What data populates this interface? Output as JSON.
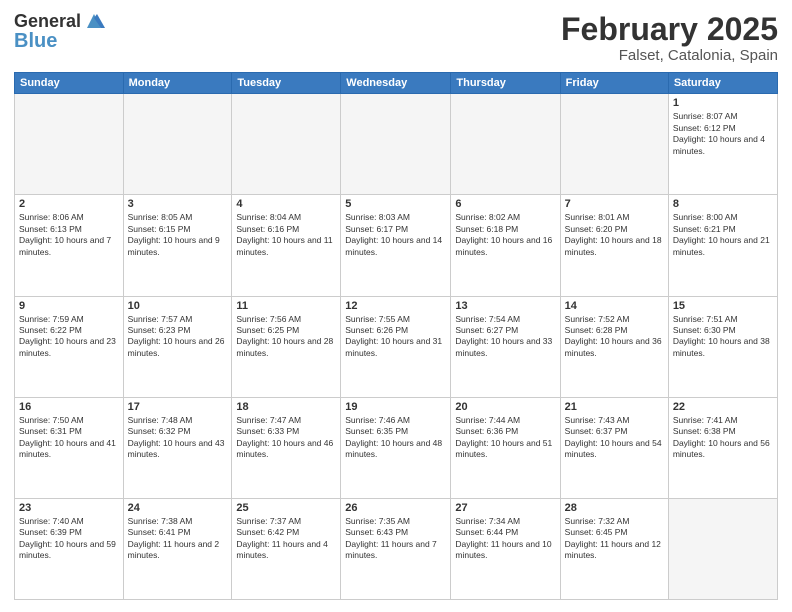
{
  "header": {
    "logo_line1": "General",
    "logo_line2": "Blue",
    "title": "February 2025",
    "subtitle": "Falset, Catalonia, Spain"
  },
  "weekdays": [
    "Sunday",
    "Monday",
    "Tuesday",
    "Wednesday",
    "Thursday",
    "Friday",
    "Saturday"
  ],
  "weeks": [
    [
      {
        "day": "",
        "info": ""
      },
      {
        "day": "",
        "info": ""
      },
      {
        "day": "",
        "info": ""
      },
      {
        "day": "",
        "info": ""
      },
      {
        "day": "",
        "info": ""
      },
      {
        "day": "",
        "info": ""
      },
      {
        "day": "1",
        "info": "Sunrise: 8:07 AM\nSunset: 6:12 PM\nDaylight: 10 hours and 4 minutes."
      }
    ],
    [
      {
        "day": "2",
        "info": "Sunrise: 8:06 AM\nSunset: 6:13 PM\nDaylight: 10 hours and 7 minutes."
      },
      {
        "day": "3",
        "info": "Sunrise: 8:05 AM\nSunset: 6:15 PM\nDaylight: 10 hours and 9 minutes."
      },
      {
        "day": "4",
        "info": "Sunrise: 8:04 AM\nSunset: 6:16 PM\nDaylight: 10 hours and 11 minutes."
      },
      {
        "day": "5",
        "info": "Sunrise: 8:03 AM\nSunset: 6:17 PM\nDaylight: 10 hours and 14 minutes."
      },
      {
        "day": "6",
        "info": "Sunrise: 8:02 AM\nSunset: 6:18 PM\nDaylight: 10 hours and 16 minutes."
      },
      {
        "day": "7",
        "info": "Sunrise: 8:01 AM\nSunset: 6:20 PM\nDaylight: 10 hours and 18 minutes."
      },
      {
        "day": "8",
        "info": "Sunrise: 8:00 AM\nSunset: 6:21 PM\nDaylight: 10 hours and 21 minutes."
      }
    ],
    [
      {
        "day": "9",
        "info": "Sunrise: 7:59 AM\nSunset: 6:22 PM\nDaylight: 10 hours and 23 minutes."
      },
      {
        "day": "10",
        "info": "Sunrise: 7:57 AM\nSunset: 6:23 PM\nDaylight: 10 hours and 26 minutes."
      },
      {
        "day": "11",
        "info": "Sunrise: 7:56 AM\nSunset: 6:25 PM\nDaylight: 10 hours and 28 minutes."
      },
      {
        "day": "12",
        "info": "Sunrise: 7:55 AM\nSunset: 6:26 PM\nDaylight: 10 hours and 31 minutes."
      },
      {
        "day": "13",
        "info": "Sunrise: 7:54 AM\nSunset: 6:27 PM\nDaylight: 10 hours and 33 minutes."
      },
      {
        "day": "14",
        "info": "Sunrise: 7:52 AM\nSunset: 6:28 PM\nDaylight: 10 hours and 36 minutes."
      },
      {
        "day": "15",
        "info": "Sunrise: 7:51 AM\nSunset: 6:30 PM\nDaylight: 10 hours and 38 minutes."
      }
    ],
    [
      {
        "day": "16",
        "info": "Sunrise: 7:50 AM\nSunset: 6:31 PM\nDaylight: 10 hours and 41 minutes."
      },
      {
        "day": "17",
        "info": "Sunrise: 7:48 AM\nSunset: 6:32 PM\nDaylight: 10 hours and 43 minutes."
      },
      {
        "day": "18",
        "info": "Sunrise: 7:47 AM\nSunset: 6:33 PM\nDaylight: 10 hours and 46 minutes."
      },
      {
        "day": "19",
        "info": "Sunrise: 7:46 AM\nSunset: 6:35 PM\nDaylight: 10 hours and 48 minutes."
      },
      {
        "day": "20",
        "info": "Sunrise: 7:44 AM\nSunset: 6:36 PM\nDaylight: 10 hours and 51 minutes."
      },
      {
        "day": "21",
        "info": "Sunrise: 7:43 AM\nSunset: 6:37 PM\nDaylight: 10 hours and 54 minutes."
      },
      {
        "day": "22",
        "info": "Sunrise: 7:41 AM\nSunset: 6:38 PM\nDaylight: 10 hours and 56 minutes."
      }
    ],
    [
      {
        "day": "23",
        "info": "Sunrise: 7:40 AM\nSunset: 6:39 PM\nDaylight: 10 hours and 59 minutes."
      },
      {
        "day": "24",
        "info": "Sunrise: 7:38 AM\nSunset: 6:41 PM\nDaylight: 11 hours and 2 minutes."
      },
      {
        "day": "25",
        "info": "Sunrise: 7:37 AM\nSunset: 6:42 PM\nDaylight: 11 hours and 4 minutes."
      },
      {
        "day": "26",
        "info": "Sunrise: 7:35 AM\nSunset: 6:43 PM\nDaylight: 11 hours and 7 minutes."
      },
      {
        "day": "27",
        "info": "Sunrise: 7:34 AM\nSunset: 6:44 PM\nDaylight: 11 hours and 10 minutes."
      },
      {
        "day": "28",
        "info": "Sunrise: 7:32 AM\nSunset: 6:45 PM\nDaylight: 11 hours and 12 minutes."
      },
      {
        "day": "",
        "info": ""
      }
    ]
  ]
}
